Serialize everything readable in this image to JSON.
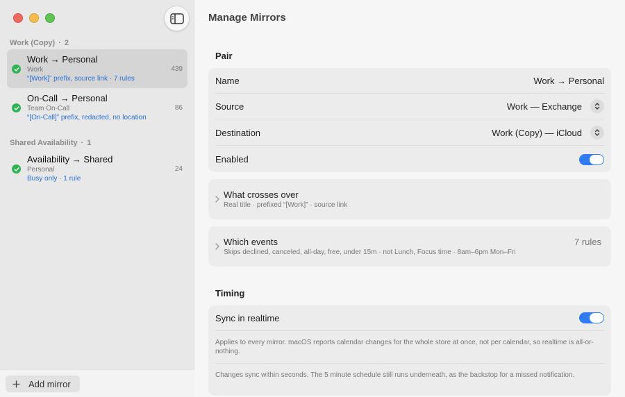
{
  "sidebar": {
    "groups": [
      {
        "name": "Work (Copy)",
        "count": "2"
      },
      {
        "name": "Shared Availability",
        "count": "1"
      }
    ],
    "mirrors": [
      {
        "title": "Work → Personal",
        "source": "Work",
        "detail": "“[Work]” prefix, source link · 7 rules",
        "count": "439",
        "status": "synced"
      },
      {
        "title": "On-Call → Personal",
        "source": "Team On-Call",
        "detail": "“[On-Call]” prefix, redacted, no location",
        "count": "86",
        "status": "synced"
      },
      {
        "title": "Availability → Shared",
        "source": "Personal",
        "detail": "Busy only · 1 rule",
        "count": "24",
        "status": "synced"
      }
    ],
    "add_button_label": "Add mirror",
    "group_dot": "·"
  },
  "main": {
    "title": "Manage Mirrors",
    "pair": {
      "section": "Pair",
      "name_label": "Name",
      "name_value": "Work → Personal",
      "source_label": "Source",
      "source_value": "Work — Exchange",
      "destination_label": "Destination",
      "destination_value": "Work (Copy) — iCloud",
      "enabled_label": "Enabled",
      "enabled": true
    },
    "crosses": {
      "title": "What crosses over",
      "subtitle": "Real title · prefixed “[Work]” · source link"
    },
    "events": {
      "title": "Which events",
      "subtitle": "Skips declined, canceled, all-day, free, under 15m · not Lunch, Focus time · 8am–6pm Mon–Fri",
      "rules": "7 rules"
    },
    "timing": {
      "section": "Timing",
      "realtime_label": "Sync in realtime",
      "realtime": true,
      "note1": "Applies to every mirror. macOS reports calendar changes for the whole store at once, not per calendar, so realtime is all-or-nothing.",
      "note2": "Changes sync within seconds. The 5 minute schedule still runs underneath, as the backstop for a missed notification."
    }
  },
  "colors": {
    "accent": "#2f7cf6",
    "success": "#2fb455",
    "link": "#2b6fd6"
  }
}
